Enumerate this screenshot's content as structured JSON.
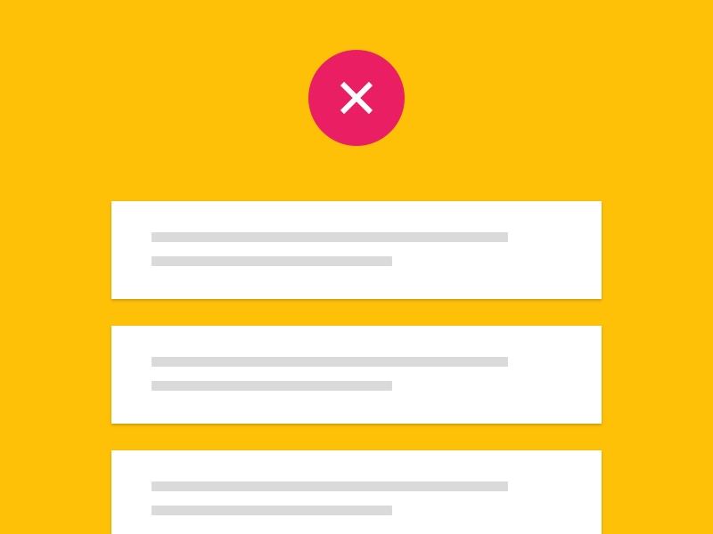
{
  "colors": {
    "background": "#FFC107",
    "fab": "#E91E63",
    "card": "#FFFFFF",
    "placeholder_line": "#DADADA"
  },
  "fab": {
    "icon": "close-icon"
  },
  "cards": [
    {
      "lines": [
        "placeholder",
        "placeholder"
      ]
    },
    {
      "lines": [
        "placeholder",
        "placeholder"
      ]
    },
    {
      "lines": [
        "placeholder",
        "placeholder"
      ]
    }
  ]
}
